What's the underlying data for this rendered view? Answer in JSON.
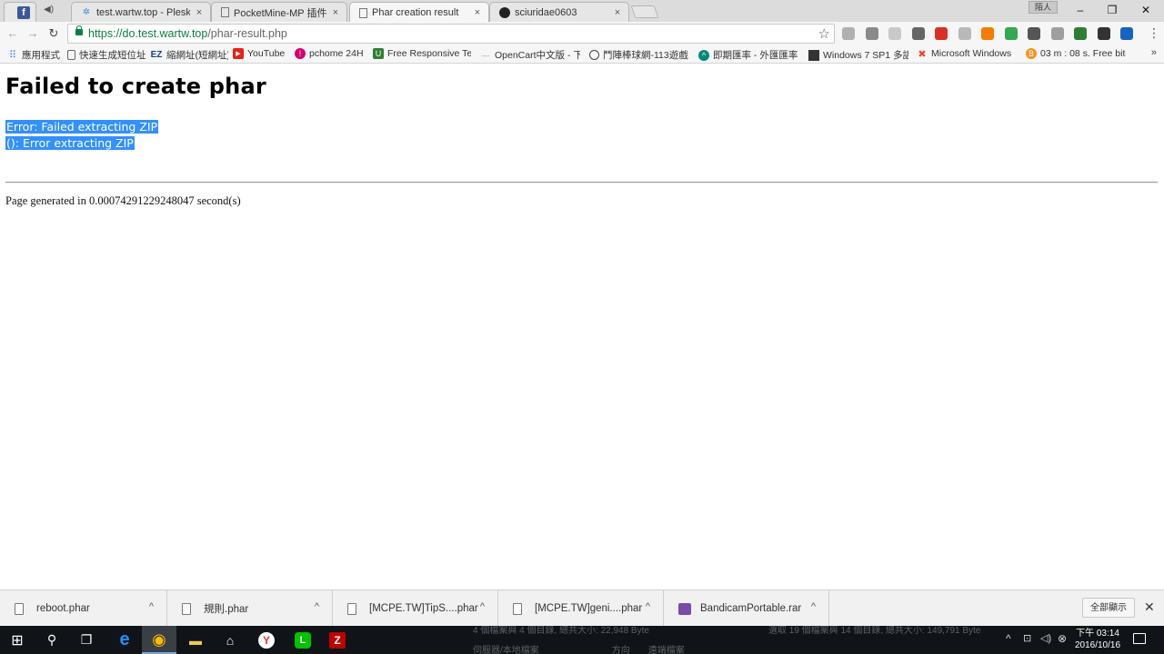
{
  "window": {
    "tabs": [
      {
        "title": "test.wartw.top - Plesk 1"
      },
      {
        "title": "PocketMine-MP 插件製"
      },
      {
        "title": "Phar creation result"
      },
      {
        "title": "sciuridae0603"
      }
    ],
    "tab_close_glyph": "×",
    "profile_label": "陌人",
    "controls": {
      "minimize": "–",
      "restore": "❐",
      "close": "✕"
    }
  },
  "toolbar": {
    "back_glyph": "←",
    "forward_glyph": "→",
    "reload_glyph": "↻",
    "url_host": "https://do.test.wartw.top",
    "url_path": "/phar-result.php",
    "star_glyph": "☆",
    "menu_glyph": "⋮",
    "extension_colors": [
      "#b0b0b0",
      "#8a8a8a",
      "#c9c9c9",
      "#666666",
      "#d93025",
      "#b9b9b9",
      "#f57c00",
      "#34a853",
      "#555555",
      "#9e9e9e",
      "#2e7d32",
      "#333333",
      "#1565c0"
    ]
  },
  "bookmarks": {
    "items": [
      {
        "label": "應用程式",
        "icon": "apps-icon"
      },
      {
        "label": "快速生成短位址",
        "icon": "page-icon"
      },
      {
        "label": "縮網址(短網址)",
        "icon": "ez-icon"
      },
      {
        "label": "YouTube",
        "icon": "youtube-icon"
      },
      {
        "label": "pchome 24H",
        "icon": "pchome-icon"
      },
      {
        "label": "Free Responsive Tem",
        "icon": "shield-icon"
      },
      {
        "label": "OpenCart中文版 - 下",
        "icon": "dash-icon"
      },
      {
        "label": "鬥陣棒球網-113遊戲",
        "icon": "ball-icon"
      },
      {
        "label": "即期匯率 - 外匯匯率",
        "icon": "rate-icon"
      },
      {
        "label": "Windows 7 SP1 多語",
        "icon": "windows-icon"
      },
      {
        "label": "Microsoft Windows",
        "icon": "joomla-icon"
      },
      {
        "label": "03 m : 08 s. Free bitc",
        "icon": "bitcoin-icon"
      }
    ],
    "more_glyph": "»"
  },
  "page": {
    "title": "Failed to create phar",
    "error_lines": [
      "Error: Failed extracting ZIP",
      "(): Error extracting ZIP"
    ],
    "generated": "Page generated in 0.00074291229248047 second(s)"
  },
  "downloads": {
    "items": [
      {
        "name": "reboot.phar",
        "type": "file"
      },
      {
        "name": "規則.phar",
        "type": "file"
      },
      {
        "name": "[MCPE.TW]TipS....phar",
        "type": "file"
      },
      {
        "name": "[MCPE.TW]geni....phar",
        "type": "file"
      },
      {
        "name": "BandicamPortable.rar",
        "type": "rar"
      }
    ],
    "caret_glyph": "^",
    "show_all_label": "全部顯示",
    "close_glyph": "✕"
  },
  "taskbar": {
    "ghost_left_1": "4 個檔案與 4 個目錄, 總共大小: 22,948 Byte",
    "ghost_left_2": "伺服器/本地檔案",
    "ghost_left_3": "方向",
    "ghost_left_4": "遠端檔案",
    "ghost_right_1": "選取 19 個檔案與 14 個目錄, 總共大小: 149,791 Byte",
    "time": "下午 03:14",
    "date": "2016/10/16",
    "tray_up_glyph": "^",
    "apps": [
      {
        "name": "windows-start",
        "glyph": "⊞"
      },
      {
        "name": "search",
        "glyph": "⚲"
      },
      {
        "name": "task-view",
        "glyph": "❐"
      },
      {
        "name": "edge",
        "glyph": "e"
      },
      {
        "name": "chrome",
        "glyph": "◉"
      },
      {
        "name": "file-explorer",
        "glyph": "▬"
      },
      {
        "name": "store",
        "glyph": "⌂"
      },
      {
        "name": "yandex",
        "glyph": "Y"
      },
      {
        "name": "line",
        "glyph": "L"
      },
      {
        "name": "filezilla",
        "glyph": "Z"
      }
    ]
  }
}
